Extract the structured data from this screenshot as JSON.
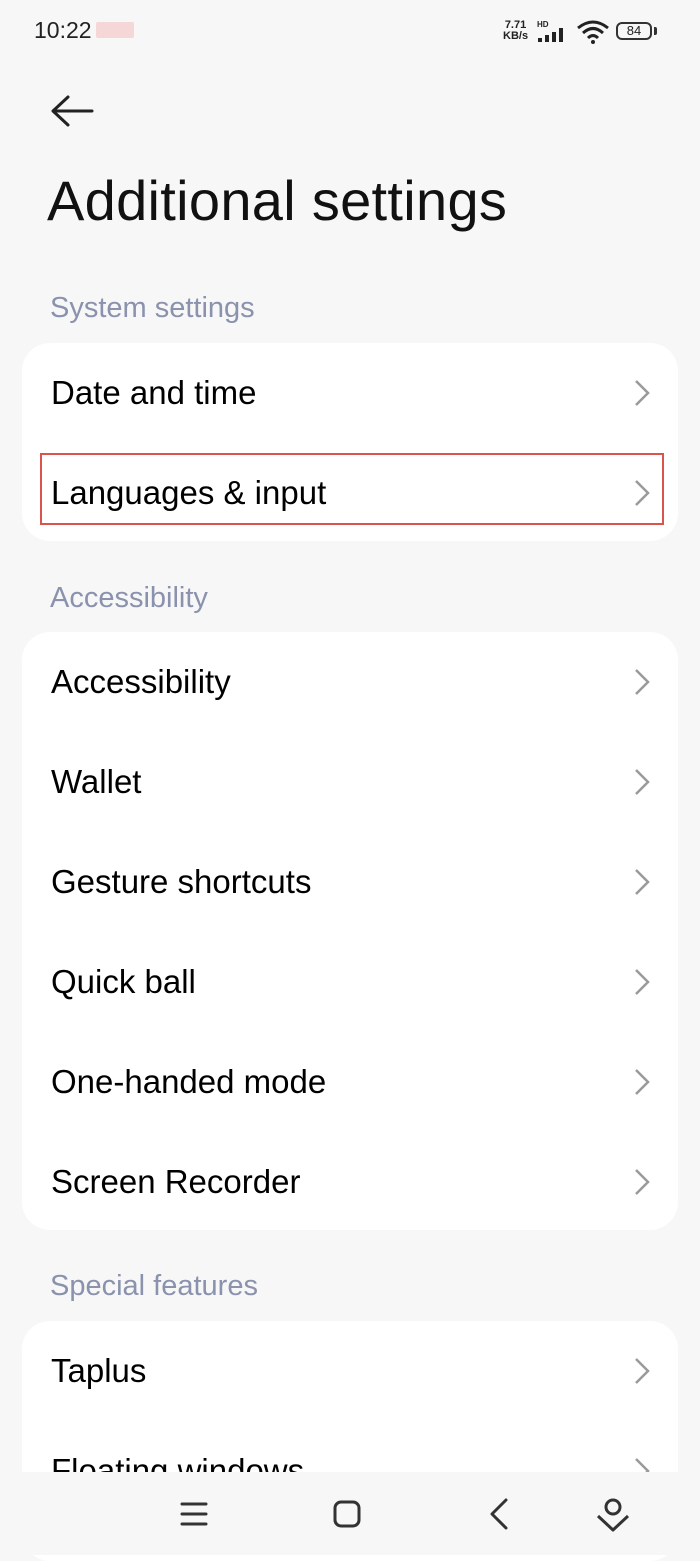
{
  "status_bar": {
    "time": "10:22",
    "net_speed_value": "7.71",
    "net_speed_unit": "KB/s",
    "network_type": "HD",
    "battery": "84",
    "icons": [
      "signal-icon",
      "wifi-icon",
      "battery-icon"
    ]
  },
  "header": {
    "back_icon": "back-arrow-icon",
    "title": "Additional settings"
  },
  "sections": [
    {
      "header": "System settings",
      "items": [
        {
          "label": "Date and time"
        },
        {
          "label": "Languages & input"
        }
      ]
    },
    {
      "header": "Accessibility",
      "items": [
        {
          "label": "Accessibility"
        },
        {
          "label": "Wallet"
        },
        {
          "label": "Gesture shortcuts"
        },
        {
          "label": "Quick ball"
        },
        {
          "label": "One-handed mode"
        },
        {
          "label": "Screen Recorder"
        }
      ]
    },
    {
      "header": "Special features",
      "items": [
        {
          "label": "Taplus"
        },
        {
          "label": "Floating windows"
        }
      ]
    }
  ],
  "highlighted_item": "Languages & input",
  "colors": {
    "background": "#f7f7f7",
    "card": "#ffffff",
    "section_header": "#8a92ad",
    "highlight_border": "#d9534f"
  },
  "nav_bar": {
    "icons": [
      "menu-icon",
      "home-icon",
      "back-icon",
      "assistant-icon"
    ]
  }
}
